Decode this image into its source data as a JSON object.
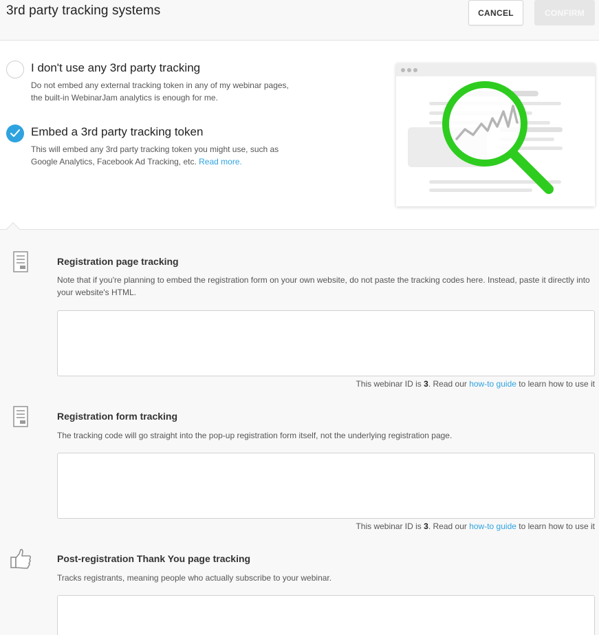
{
  "header": {
    "title": "3rd party tracking systems",
    "cancel_label": "CANCEL",
    "confirm_label": "CONFIRM"
  },
  "options": [
    {
      "title": "I don't use any 3rd party tracking",
      "description": "Do not embed any external tracking token in any of my webinar pages, the built-in WebinarJam analytics is enough for me.",
      "selected": false
    },
    {
      "title": "Embed a 3rd party tracking token",
      "description": "This will embed any 3rd party tracking token you might use, such as Google Analytics, Facebook Ad Tracking, etc.",
      "link_text": "Read more.",
      "selected": true
    }
  ],
  "illustration": {
    "icon": "magnifier-chart-icon",
    "accent_color": "#2ecc1f"
  },
  "sections": [
    {
      "icon": "document-icon",
      "title": "Registration page tracking",
      "description": "Note that if you're planning to embed the registration form on your own website, do not paste the tracking codes here. Instead, paste it directly into your website's HTML.",
      "value": "",
      "note_pre": "This webinar ID is ",
      "webinar_id": "3",
      "note_mid": ". Read our ",
      "note_link": "how-to guide",
      "note_post": " to learn how to use it"
    },
    {
      "icon": "document-icon",
      "title": "Registration form tracking",
      "description": "The tracking code will go straight into the pop-up registration form itself, not the underlying registration page.",
      "value": "",
      "note_pre": "This webinar ID is ",
      "webinar_id": "3",
      "note_mid": ". Read our ",
      "note_link": "how-to guide",
      "note_post": " to learn how to use it"
    },
    {
      "icon": "thumbs-up-icon",
      "title": "Post-registration Thank You page tracking",
      "description": "Tracks registrants, meaning people who actually subscribe to your webinar.",
      "value": ""
    }
  ],
  "colors": {
    "accent": "#2fa3df",
    "illustration_green": "#2ecc1f"
  }
}
